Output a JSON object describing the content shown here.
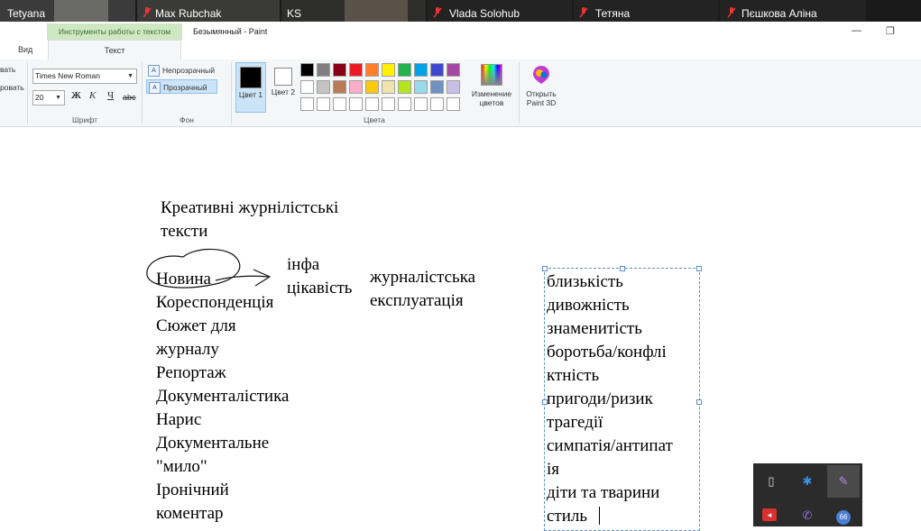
{
  "zoom_strip": {
    "participants": [
      "Tetyana",
      "Max Rubchak",
      "KS",
      "Vlada Solohub",
      "Тетяна",
      "Пєшкова Аліна"
    ]
  },
  "window": {
    "context_tab": "Инструменты работы с текстом",
    "title": "Безымянный - Paint",
    "minimize": "—",
    "restore": "❐"
  },
  "tabs": {
    "view": "Вид",
    "text": "Текст"
  },
  "ribbon": {
    "clipboard_partial_1": "вать",
    "clipboard_partial_2": "ровать",
    "font": {
      "family": "Times New Roman",
      "size": "20",
      "bold": "Ж",
      "italic": "К",
      "underline": "Ч",
      "strike": "abc",
      "group_label": "Шрифт"
    },
    "background": {
      "opaque": "Непрозрачный",
      "transparent": "Прозрачный",
      "group_label": "Фон"
    },
    "colors": {
      "color1": "Цвет 1",
      "color2": "Цвет 2",
      "color1_value": "#000000",
      "color2_value": "#ffffff",
      "edit": "Изменение цветов",
      "group_label": "Цвета",
      "palette_row1": [
        "#000000",
        "#7f7f7f",
        "#880015",
        "#ed1c24",
        "#ff7f27",
        "#fff200",
        "#22b14c",
        "#00a2e8",
        "#3f48cc",
        "#a349a4"
      ],
      "palette_row2": [
        "#ffffff",
        "#c3c3c3",
        "#b97a57",
        "#ffaec9",
        "#ffc90e",
        "#efe4b0",
        "#b5e61d",
        "#99d9ea",
        "#7092be",
        "#c8bfe7"
      ],
      "palette_row3": [
        "#ffffff",
        "#ffffff",
        "#ffffff",
        "#ffffff",
        "#ffffff",
        "#ffffff",
        "#ffffff",
        "#ffffff",
        "#ffffff",
        "#ffffff"
      ]
    },
    "paint3d": "Открыть Paint 3D"
  },
  "canvas": {
    "heading_line1": "Креативні журнілістські",
    "heading_line2": "тексти",
    "genres": [
      "Новина",
      "Кореспонденція",
      "Сюжет для",
      "журналу",
      "Репортаж",
      "Документалістика",
      "Нарис",
      "Документальне",
      "\"мило\"",
      "Іронічний",
      "коментар"
    ],
    "info_line1": "інфа",
    "info_line2": "цікавість",
    "exploit_line1": "журналістська",
    "exploit_line2": "експлуатація",
    "textbox_lines": [
      "близькість",
      "дивожність",
      "знаменитість",
      "боротьба/конфлі",
      "ктність",
      "пригоди/ризик",
      "трагедії",
      "симпатія/антипат",
      "ія",
      "діти та тварини",
      "стиль"
    ]
  },
  "tray": {
    "badge": "66"
  }
}
